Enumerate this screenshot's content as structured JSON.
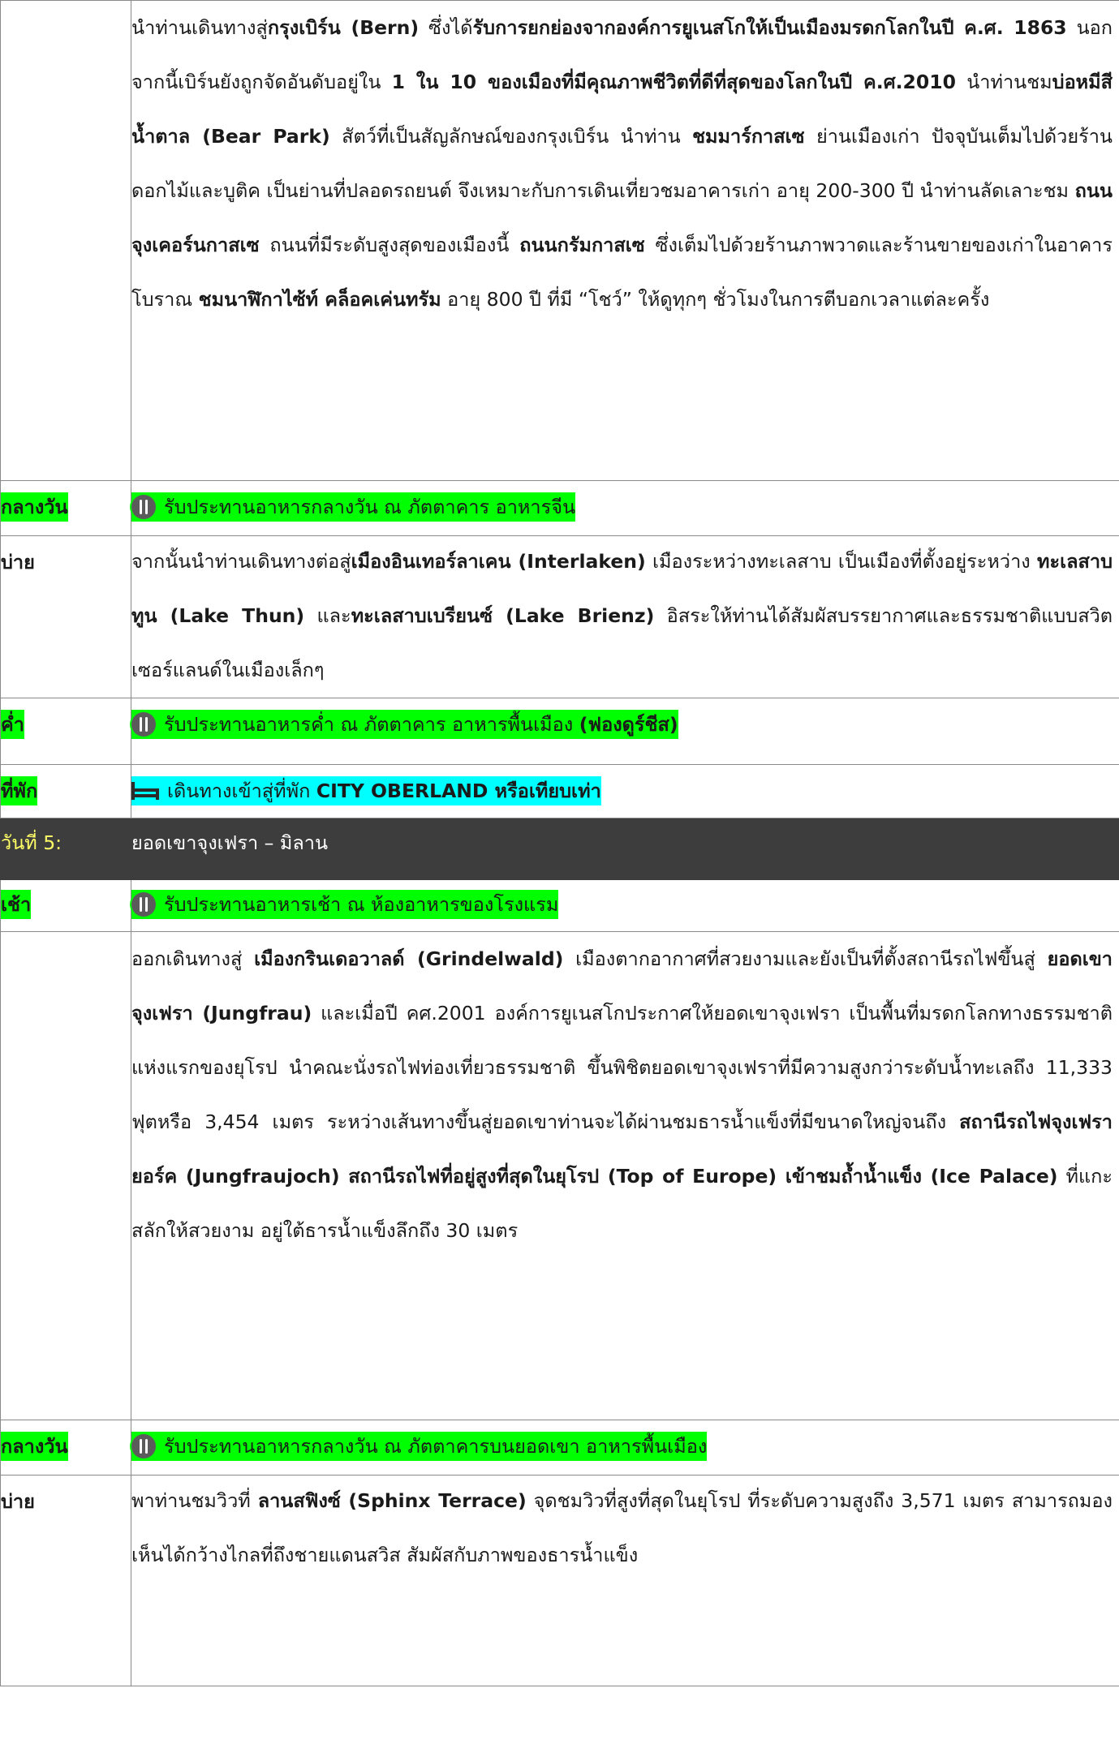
{
  "paragraph1": {
    "segments": [
      {
        "t": "นำท่านเดินทางสู่",
        "b": false
      },
      {
        "t": "กรุงเบิร์น (Bern)",
        "b": true
      },
      {
        "t": " ซึ่งได้",
        "b": false
      },
      {
        "t": "รับการยกย่องจากองค์การยูเนสโกให้เป็นเมืองมรดกโลกในปี ค.ศ. 1863",
        "b": true
      },
      {
        "t": " นอกจากนี้เบิร์นยังถูกจัดอันดับอยู่ใน ",
        "b": false
      },
      {
        "t": "1 ใน 10 ของเมืองที่มีคุณภาพชีวิตที่ดีที่สุดของโลกในปี ค.ศ.2010",
        "b": true
      },
      {
        "t": " นำท่านชม",
        "b": false
      },
      {
        "t": "บ่อหมีสีน้ำตาล (Bear  Park)",
        "b": true
      },
      {
        "t": " สัตว์ที่เป็นสัญลักษณ์ของกรุงเบิร์น นำท่าน  ",
        "b": false
      },
      {
        "t": "ชมมาร์กาสเซ",
        "b": true
      },
      {
        "t": " ย่านเมืองเก่า ปัจจุบันเต็มไปด้วยร้านดอกไม้และบูติค เป็นย่านที่ปลอดรถยนต์ จึงเหมาะกับการเดินเที่ยวชมอาคารเก่า อายุ 200-300 ปี นำท่านลัดเลาะชม ",
        "b": false
      },
      {
        "t": "ถนนจุงเคอร์นกาสเซ",
        "b": true
      },
      {
        "t": " ถนนที่มีระดับสูงสุดของเมืองนี้ ",
        "b": false
      },
      {
        "t": "ถนนกรัมกาสเซ",
        "b": true
      },
      {
        "t": " ซึ่งเต็มไปด้วยร้านภาพวาดและร้านขายของเก่าในอาคารโบราณ ",
        "b": false
      },
      {
        "t": "ชมนาฬิกาไซ้ท์ คล็อคเค่นทรัม",
        "b": true
      },
      {
        "t": " อายุ 800 ปี ที่มี “โชว์” ให้ดูทุกๆ ชั่วโมงในการตีบอกเวลาแต่ละครั้ง",
        "b": false
      }
    ]
  },
  "row_lunch1": {
    "label": "กลางวัน",
    "icon": "restaurant-icon",
    "text": "รับประทานอาหารกลางวัน ณ ภัตตาคาร อาหารจีน"
  },
  "row_afternoon1": {
    "label": "บ่าย",
    "segments": [
      {
        "t": "จากนั้นนำท่านเดินทางต่อสู่",
        "b": false
      },
      {
        "t": "เมืองอินเทอร์ลาเคน (Interlaken)",
        "b": true
      },
      {
        "t": "  เมืองระหว่างทะเลสาบ เป็นเมืองที่ตั้งอยู่ระหว่าง ",
        "b": false
      },
      {
        "t": "ทะเลสาบทูน (Lake  Thun)",
        "b": true
      },
      {
        "t": " และ",
        "b": false
      },
      {
        "t": "ทะเลสาบเบรียนซ์ (Lake  Brienz)",
        "b": true
      },
      {
        "t": " อิสระให้ท่านได้สัมผัสบรรยากาศและธรรมชาติแบบสวิตเซอร์แลนด์ในเมืองเล็กๆ",
        "b": false
      }
    ]
  },
  "row_dinner": {
    "label": "ค่ำ",
    "icon": "restaurant-icon",
    "text": "รับประทานอาหารค่ำ ณ ภัตตาคาร อาหารพื้นเมือง ",
    "text_bold": "(ฟองดูร์ชีส)"
  },
  "row_hotel": {
    "label": "ที่พัก",
    "icon": "bed-icon",
    "text": "เดินทางเข้าสู่ที่พัก ",
    "text_bold": "CITY OBERLAND หรือเทียบเท่า"
  },
  "day5": {
    "label": "วันที่ 5:",
    "title": "ยอดเขาจุงเฟรา – มิลาน"
  },
  "row_breakfast": {
    "label": "เช้า",
    "icon": "restaurant-icon",
    "text": "รับประทานอาหารเช้า ณ ห้องอาหารของโรงแรม"
  },
  "paragraph2": {
    "segments": [
      {
        "t": "ออกเดินทางสู่ ",
        "b": false
      },
      {
        "t": "เมืองกรินเดอวาลด์ (Grindelwald)",
        "b": true
      },
      {
        "t": " เมืองตากอากาศที่สวยงามและยังเป็นที่ตั้งสถานีรถไฟขึ้นสู่ ",
        "b": false
      },
      {
        "t": "ยอดเขาจุงเฟรา (Jungfrau)",
        "b": true
      },
      {
        "t": " และเมื่อปี คศ.2001  องค์การยูเนสโกประกาศให้ยอดเขาจุงเฟรา เป็นพื้นที่มรดกโลกทางธรรมชาติแห่งแรกของยุโรป นำคณะนั่งรถไฟท่องเที่ยวธรรมชาติ ขึ้นพิชิตยอดเขาจุงเฟราที่มีความสูงกว่าระดับน้ำทะเลถึง 11,333 ฟุตหรือ 3,454 เมตร ระหว่างเส้นทางขึ้นสู่ยอดเขาท่านจะได้ผ่านชมธารน้ำแข็งที่มีขนาดใหญ่จนถึง ",
        "b": false
      },
      {
        "t": "สถานีรถไฟจุงเฟรายอร์ค (Jungfraujoch) สถานีรถไฟที่อยู่สูงที่สุดในยุโรป (Top  of  Europe) เข้าชมถ้ำน้ำแข็ง (Ice Palace)",
        "b": true
      },
      {
        "t": " ที่แกะสลักให้สวยงาม อยู่ใต้ธารน้ำแข็งลึกถึง 30 เมตร",
        "b": false
      }
    ]
  },
  "row_lunch2": {
    "label": "กลางวัน",
    "icon": "restaurant-icon",
    "text": "รับประทานอาหารกลางวัน ณ ภัตตาคารบนยอดเขา อาหารพื้นเมือง"
  },
  "row_afternoon2": {
    "label": "บ่าย",
    "segments": [
      {
        "t": "พาท่านชมวิวที่ ",
        "b": false
      },
      {
        "t": "ลานสฟิงซ์ (Sphinx   Terrace)",
        "b": true
      },
      {
        "t": " จุดชมวิวที่สูงที่สุดในยุโรป ที่ระดับความสูงถึง 3,571 เมตร สามารถมองเห็นได้กว้างไกลที่ถึงชายแดนสวิส สัมผัสกับภาพของธารน้ำแข็ง",
        "b": false
      }
    ]
  }
}
